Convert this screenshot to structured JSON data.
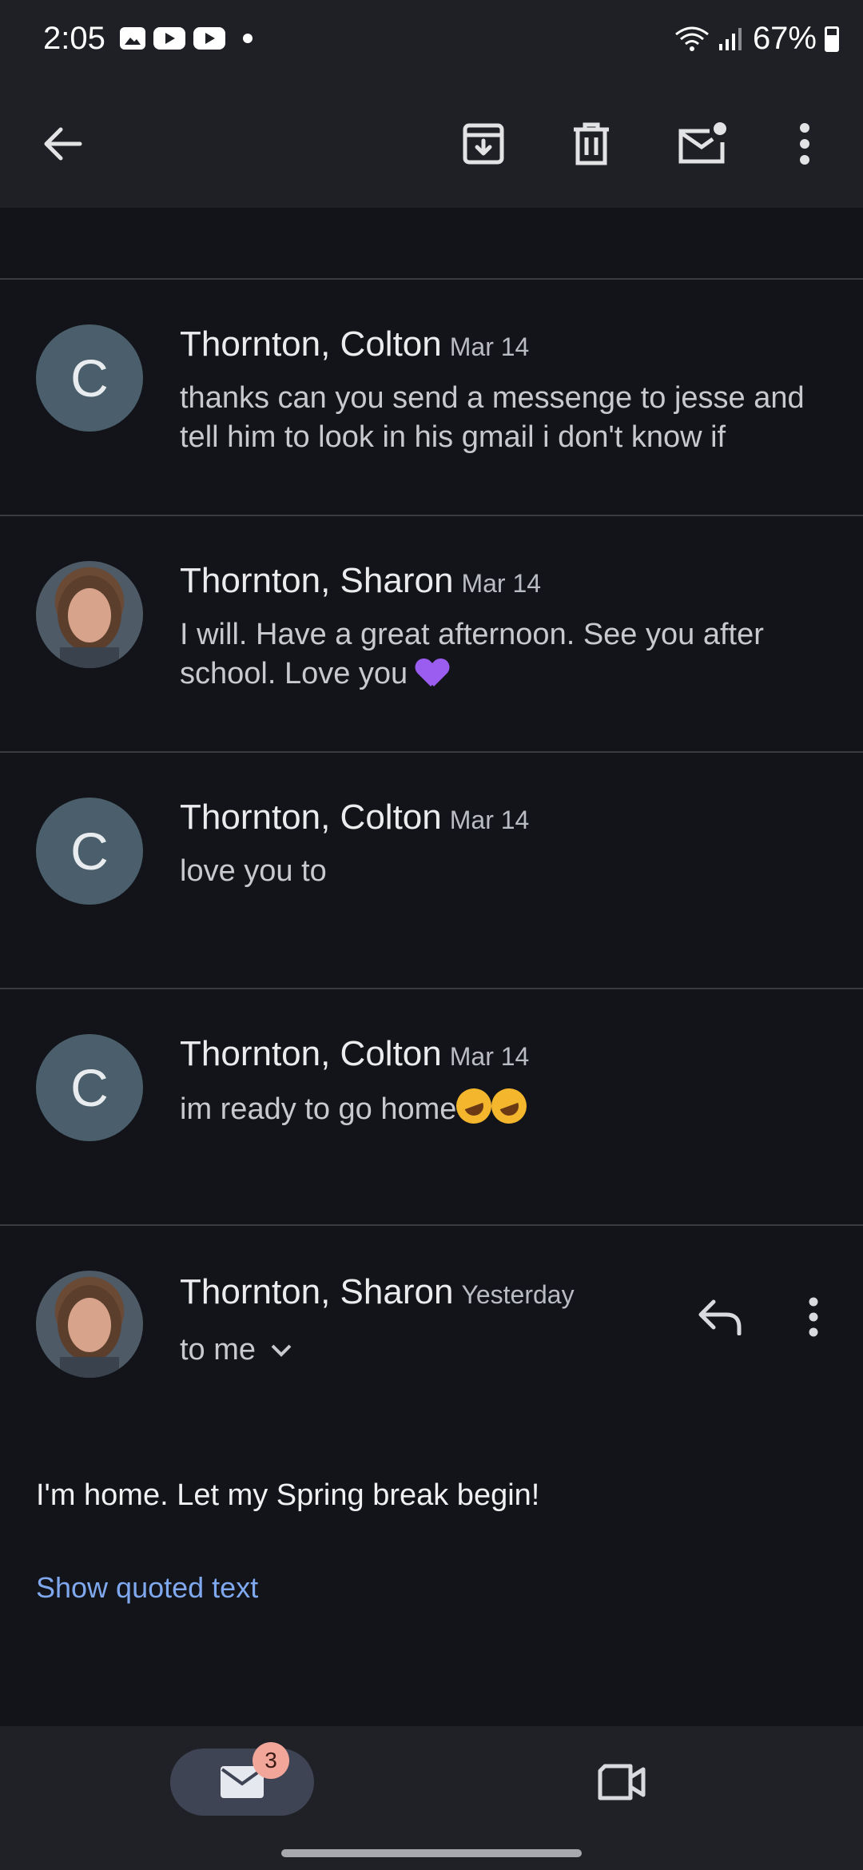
{
  "status_bar": {
    "time": "2:05",
    "battery": "67%",
    "icons": [
      "gallery-icon",
      "youtube-icon",
      "youtube-icon",
      "notification-dot",
      "wifi-icon",
      "signal-icon",
      "battery-icon"
    ]
  },
  "toolbar": {
    "back": "back-arrow-icon",
    "archive": "archive-icon",
    "delete": "delete-icon",
    "mark_unread": "mark-unread-icon",
    "more": "more-vert-icon"
  },
  "thread": [
    {
      "sender": "Thornton, Colton",
      "date": "Mar 14",
      "avatar_letter": "C",
      "snippet": "thanks can you send a messenge to jesse and tell him to look in his gmail i don't know if"
    },
    {
      "sender": "Thornton, Sharon",
      "date": "Mar 14",
      "snippet": "I will. Have a great afternoon. See you after school. Love you"
    },
    {
      "sender": "Thornton, Colton",
      "date": "Mar 14",
      "avatar_letter": "C",
      "snippet": "love you to"
    },
    {
      "sender": "Thornton, Colton",
      "date": "Mar 14",
      "avatar_letter": "C",
      "snippet": "im ready to go home"
    }
  ],
  "expanded_message": {
    "sender": "Thornton, Sharon",
    "date": "Yesterday",
    "recipient": "to me",
    "body": "I'm home. Let my Spring break begin!",
    "show_quoted": "Show quoted text"
  },
  "bottom_nav": {
    "mail_badge": "3",
    "mail_icon": "mail-icon",
    "meet_icon": "video-icon"
  },
  "colors": {
    "background": "#131419",
    "link": "#7fa8ee",
    "avatar": "#4a5f6b",
    "badge": "#f2a69a"
  }
}
